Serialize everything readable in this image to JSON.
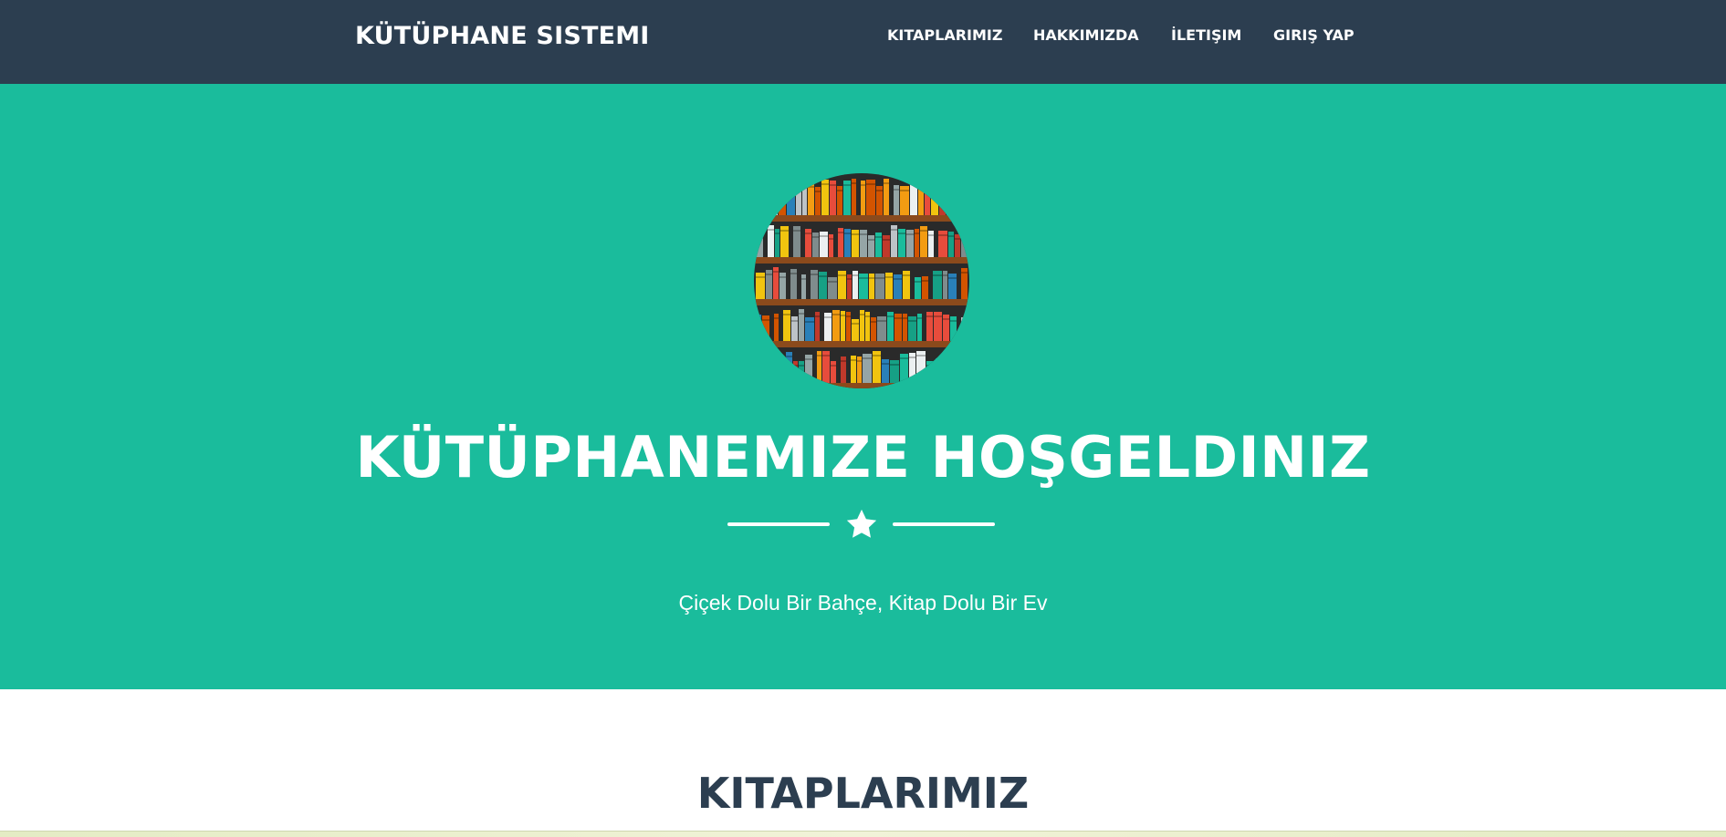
{
  "navbar": {
    "brand": "KÜTÜPHANE SISTEMI",
    "links": [
      {
        "label": "KITAPLARIMIZ"
      },
      {
        "label": "HAKKIMIZDA"
      },
      {
        "label": "İLETIŞIM"
      },
      {
        "label": "GIRIŞ YAP"
      }
    ]
  },
  "hero": {
    "avatar_icon": "bookshelf-illustration",
    "title": "KÜTÜPHANEMIZE HOŞGELDINIZ",
    "divider_icon": "star-icon",
    "tagline": "Çiçek Dolu Bir Bahçe, Kitap Dolu Bir Ev"
  },
  "section": {
    "title": "KITAPLARIMIZ"
  },
  "colors": {
    "navbar_bg": "#2c3e50",
    "hero_bg": "#1abc9c",
    "text_light": "#ffffff",
    "text_dark": "#2c3e50"
  }
}
